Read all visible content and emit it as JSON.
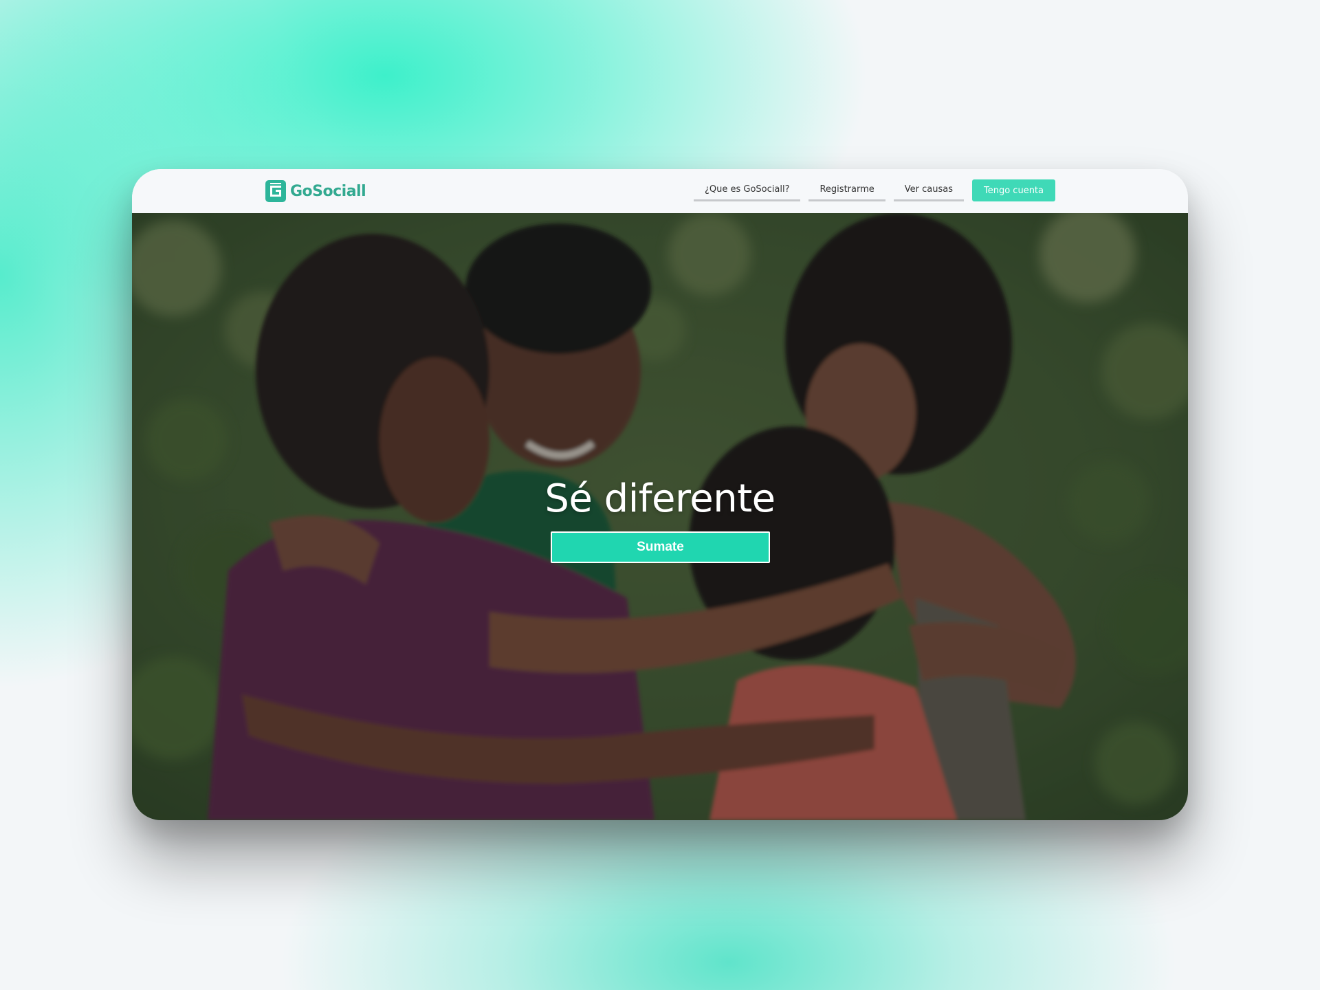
{
  "brand": {
    "name": "GoSociall",
    "accent": "#3fd9b7",
    "logo_color": "#2db59a"
  },
  "nav": {
    "links": [
      {
        "label": "¿Que es GoSociall?"
      },
      {
        "label": "Registrarme"
      },
      {
        "label": "Ver causas"
      }
    ],
    "cta_label": "Tengo cuenta"
  },
  "hero": {
    "headline": "Sé diferente",
    "button_label": "Sumate",
    "button_color": "#20d6b0",
    "image_subject": "children-hugging-photo"
  }
}
